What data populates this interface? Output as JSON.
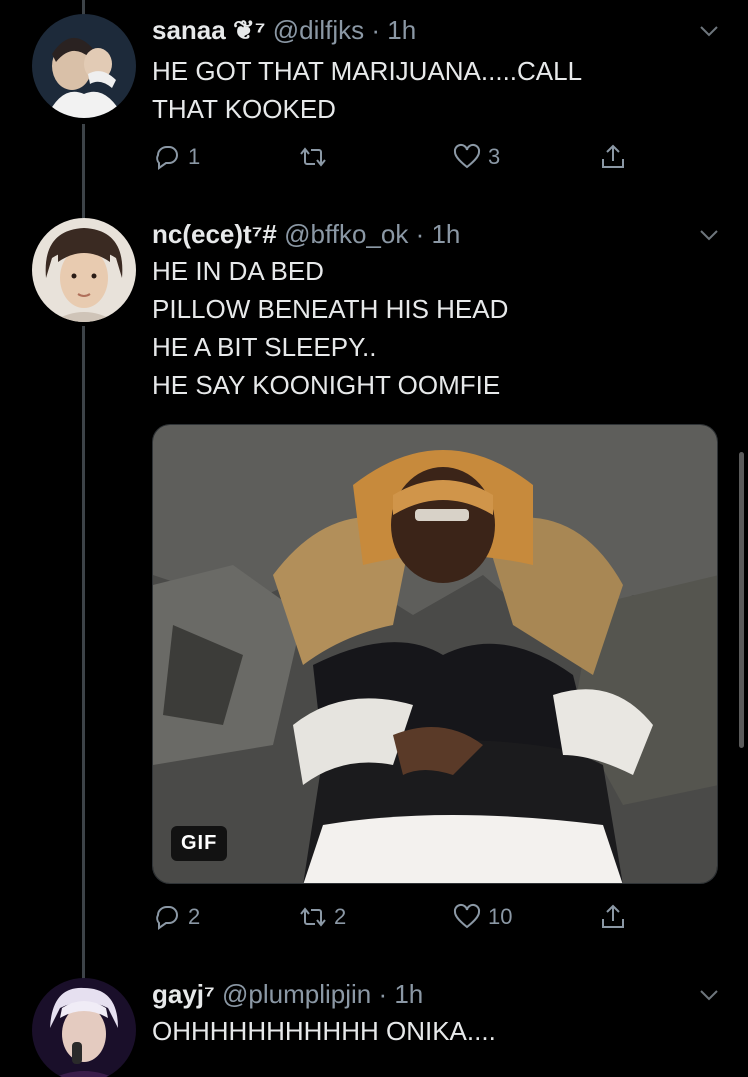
{
  "tweets": [
    {
      "name": "sanaa",
      "name_suffix": "❦⁷",
      "handle": "@dilfjks",
      "time": "· 1h",
      "text": "HE GOT THAT MARIJUANA.....CALL\nTHAT KOOKED",
      "replies": "1",
      "retweets": "",
      "likes": "3"
    },
    {
      "name": "nc(ece)t⁷#",
      "handle": "@bffko_ok",
      "time": "· 1h",
      "text": "HE IN DA BED\nPILLOW BENEATH HIS HEAD\nHE A BIT SLEEPY..\nHE SAY KOONIGHT OOMFIE",
      "media_badge": "GIF",
      "replies": "2",
      "retweets": "2",
      "likes": "10"
    },
    {
      "name": "gayj⁷",
      "handle": "@plumplipjin",
      "time": "· 1h",
      "text": "OHHHHHHHHHHH ONIKA...."
    }
  ],
  "icons": {
    "reply": "reply-icon",
    "retweet": "retweet-icon",
    "like": "heart-icon",
    "share": "share-icon",
    "more": "chevron-down-icon"
  },
  "colors": {
    "background": "#000000",
    "text": "#e7e9ea",
    "secondary": "#8b98a5",
    "thread_line": "#3d4348"
  }
}
